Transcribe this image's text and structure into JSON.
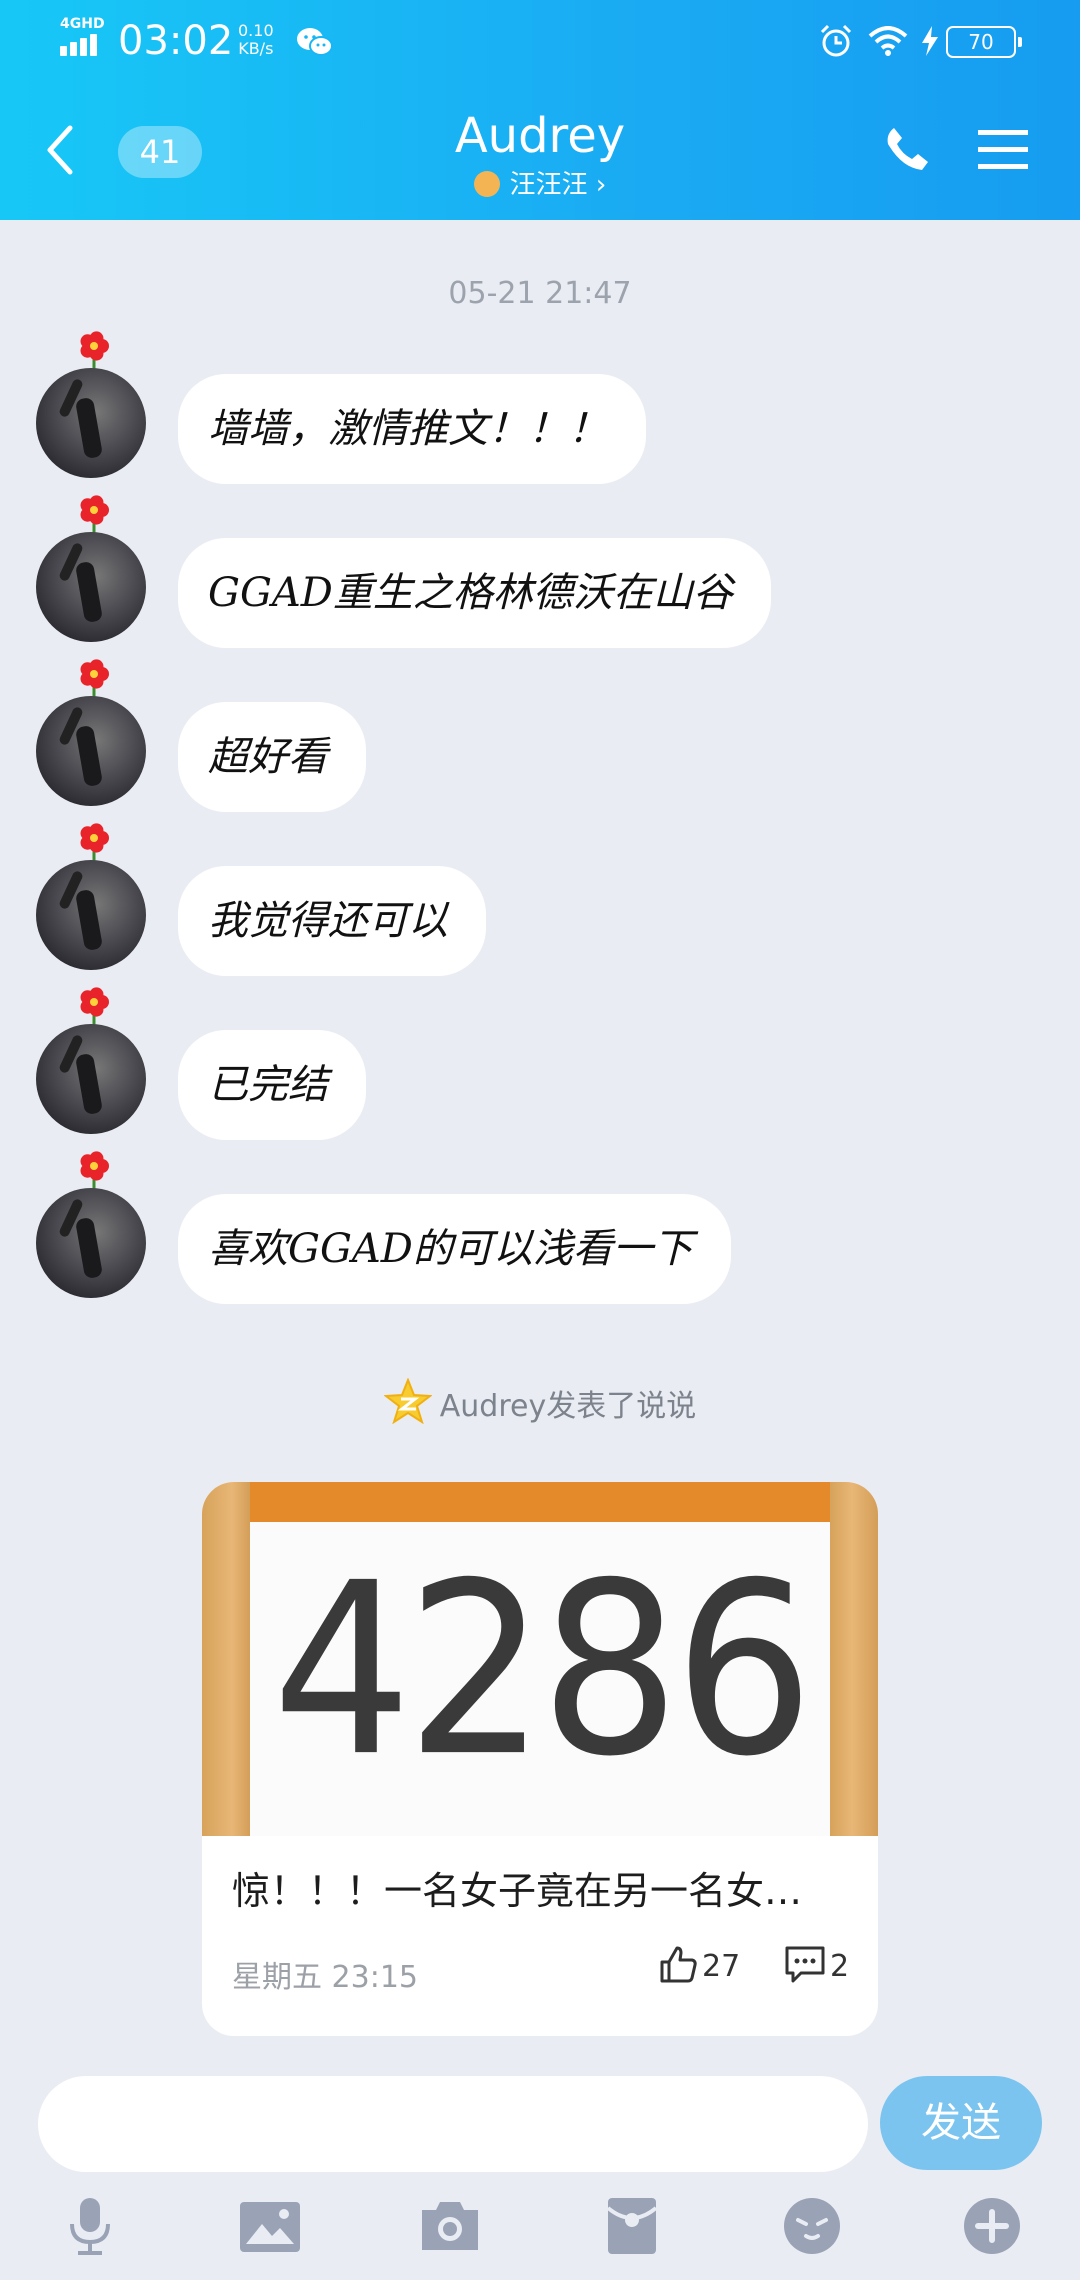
{
  "status_bar": {
    "network": "4GHD",
    "time": "03:02",
    "speed_value": "0.10",
    "speed_unit": "KB/s",
    "battery": "70"
  },
  "header": {
    "unread_count": "41",
    "title": "Audrey",
    "subtitle": "汪汪汪",
    "accent_color": "#1aaaf3"
  },
  "timestamp": "05-21 21:47",
  "messages": [
    {
      "text": "墙墙，激情推文！！！"
    },
    {
      "text": "GGAD重生之格林德沃在山谷"
    },
    {
      "text": "超好看"
    },
    {
      "text": "我觉得还可以"
    },
    {
      "text": "已完结"
    },
    {
      "text": "喜欢GGAD的可以浅看一下"
    }
  ],
  "post_notice": "Audrey发表了说说",
  "post_card": {
    "image_number": "4286",
    "title": "惊！！！一名女子竟在另一名女…",
    "time": "星期五 23:15",
    "likes": "27",
    "comments": "2"
  },
  "input": {
    "placeholder": "",
    "send_label": "发送"
  },
  "toolbar_icons": [
    "microphone-icon",
    "image-icon",
    "camera-icon",
    "red-packet-icon",
    "emoji-icon",
    "plus-icon"
  ]
}
